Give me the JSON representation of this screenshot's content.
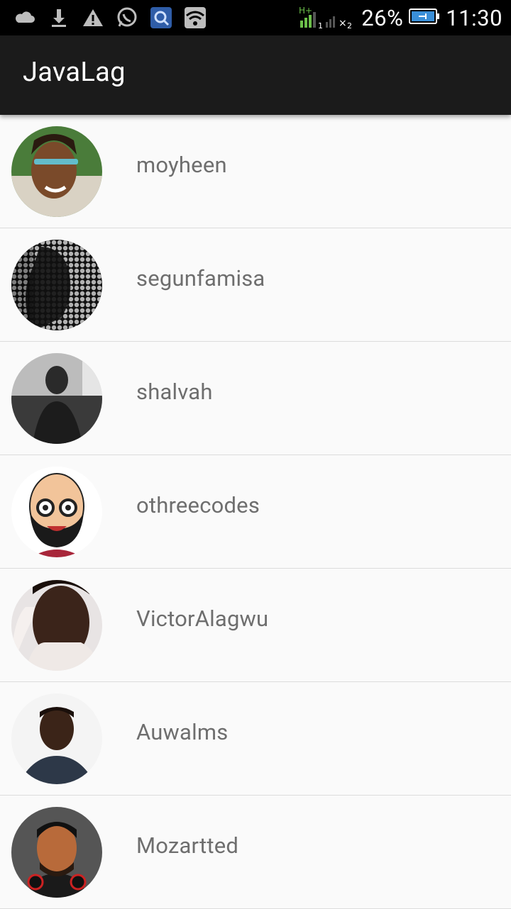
{
  "status_bar": {
    "network": "H+",
    "sim1": "1",
    "sim2": "2",
    "battery_percent": "26%",
    "time": "11:30",
    "icons": [
      "cloud-icon",
      "download-icon",
      "warning-icon",
      "whatsapp-icon",
      "search-app-icon",
      "wifi-icon",
      "signal-icon",
      "battery-icon"
    ]
  },
  "toolbar": {
    "title": "JavaLag"
  },
  "users": [
    {
      "username": "moyheen"
    },
    {
      "username": "segunfamisa"
    },
    {
      "username": "shalvah"
    },
    {
      "username": "othreecodes"
    },
    {
      "username": "VictorAlagwu"
    },
    {
      "username": "Auwalms"
    },
    {
      "username": "Mozartted"
    }
  ]
}
